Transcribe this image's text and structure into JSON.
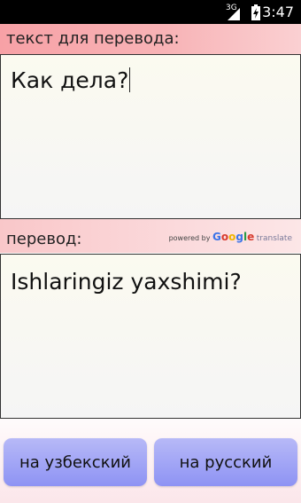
{
  "status_bar": {
    "network": "3G",
    "time": "3:47"
  },
  "source": {
    "label": "текст для перевода:",
    "text": "Как дела?"
  },
  "target": {
    "label": "перевод:",
    "text": "Ishlaringiz yaxshimi?",
    "powered_prefix": "powered by",
    "google_letters": [
      "G",
      "o",
      "o",
      "g",
      "l",
      "e"
    ],
    "translate_word": "translate"
  },
  "buttons": {
    "to_uzbek": "на узбекский",
    "to_russian": "на русский"
  },
  "colors": {
    "header_pink": "#f7a1a6",
    "button_blue": "#8e93f4"
  }
}
